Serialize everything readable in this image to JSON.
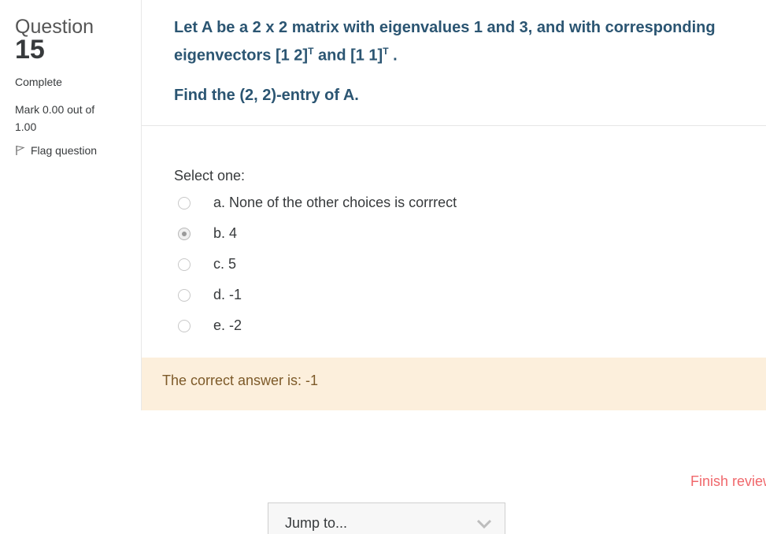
{
  "question_info": {
    "label": "Question",
    "number": "15",
    "state": "Complete",
    "grade": "Mark 0.00 out of 1.00",
    "flag_label": "Flag question"
  },
  "question": {
    "line1": "Let A be a 2 x 2 matrix with eigenvalues 1 and 3, and with corresponding",
    "line2_a": "eigenvectors [1 2]",
    "sup": "T",
    "line2_b": " and [1 1]",
    "line2_c": " .",
    "find": "Find the (2, 2)-entry of A."
  },
  "answer": {
    "prompt": "Select one:",
    "options": [
      {
        "label": "a. None of the other choices is corrrect",
        "selected": false
      },
      {
        "label": "b. 4",
        "selected": true
      },
      {
        "label": "c. 5",
        "selected": false
      },
      {
        "label": "d. -1",
        "selected": false
      },
      {
        "label": "e. -2",
        "selected": false
      }
    ]
  },
  "feedback": {
    "right_answer": "The correct answer is: -1"
  },
  "navigation": {
    "finish_review": "Finish review",
    "jump_placeholder": "Jump to..."
  },
  "colors": {
    "question_text": "#2b5572",
    "feedback_bg": "#fcefdc",
    "feedback_text": "#7d5a29",
    "finish_link": "#f0676b"
  }
}
